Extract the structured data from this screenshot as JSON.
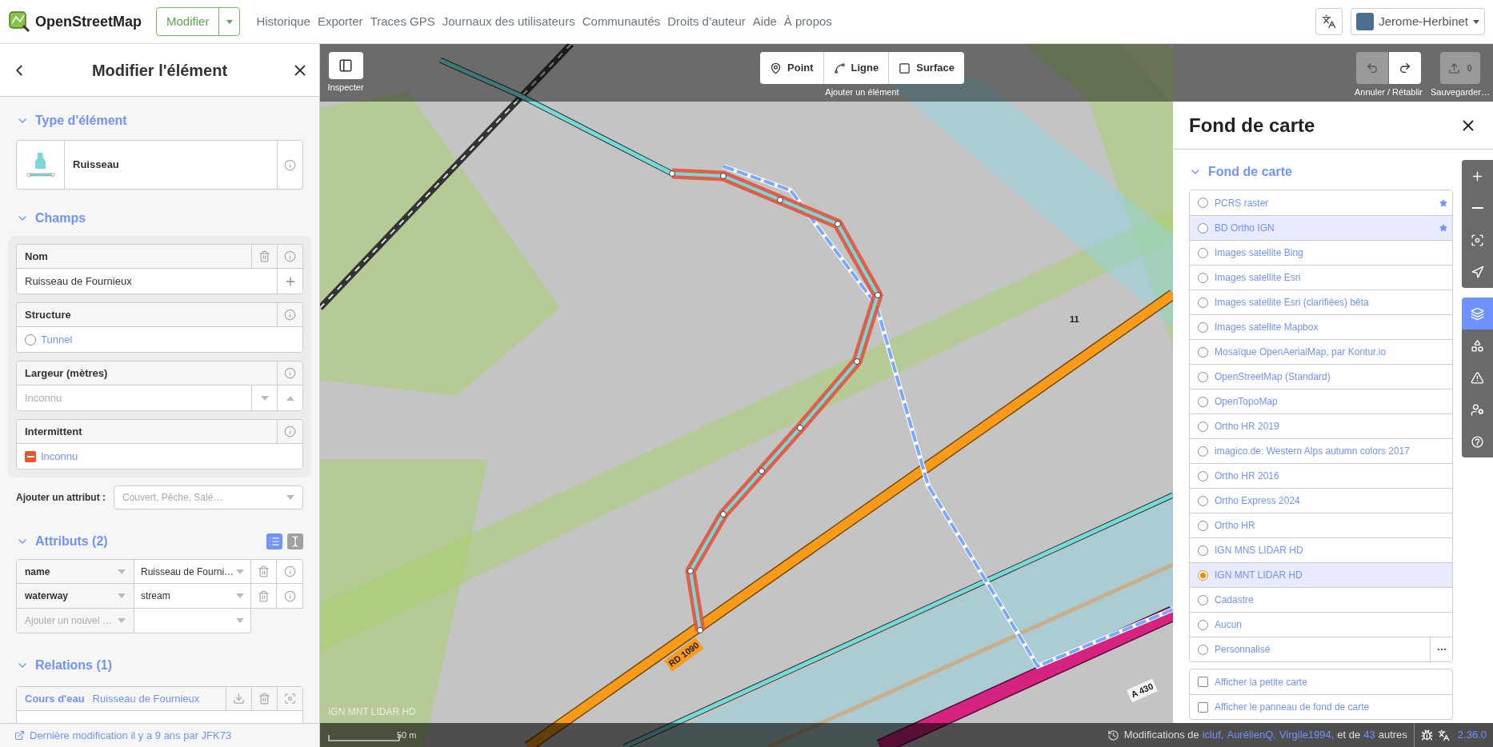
{
  "nav": {
    "logo": "OpenStreetMap",
    "edit": "Modifier",
    "links": [
      "Historique",
      "Exporter",
      "Traces GPS",
      "Journaux des utilisateurs",
      "Communautés",
      "Droits d’auteur",
      "Aide",
      "À propos"
    ],
    "user": "Jerome-Herbinet"
  },
  "sidebar": {
    "title": "Modifier l'élément",
    "preset_section": {
      "title": "Type d'élément",
      "expanded": true
    },
    "preset": "Ruisseau",
    "fields_section": {
      "title": "Champs",
      "expanded": true
    },
    "fields": [
      {
        "kind": "text",
        "label": "Nom",
        "value": "Ruisseau de Fournieux"
      },
      {
        "kind": "check",
        "label": "Structure",
        "option": "Tunnel",
        "checked": false
      },
      {
        "kind": "number",
        "label": "Largeur (mètres)",
        "placeholder": "Inconnu"
      },
      {
        "kind": "tristate",
        "label": "Intermittent",
        "option": "Inconnu",
        "indeterminate": true
      }
    ],
    "add_field": {
      "label": "Ajouter un attribut :",
      "placeholder": "Couvert, Pêche, Salé…"
    },
    "tags_section": {
      "title": "Attributs (2)",
      "expanded": true
    },
    "tag_views": [
      {
        "kind": "list",
        "selected": true
      },
      {
        "kind": "text",
        "selected": false
      }
    ],
    "tags": [
      {
        "key": "name",
        "value": "Ruisseau de Fourni…"
      },
      {
        "key": "waterway",
        "value": "stream"
      }
    ],
    "new_tag_placeholder": "Ajouter un nouvel …",
    "relations_section": {
      "title": "Relations (1)",
      "expanded": true
    },
    "relations": [
      {
        "role": "Cours d'eau",
        "name": "Ruisseau de Fournieux"
      }
    ],
    "footer": "Dernière modification il y a 9 ans par JFK73"
  },
  "toolbar": {
    "inspect": "Inspecter",
    "modes": [
      {
        "kind": "point",
        "label": "Point"
      },
      {
        "kind": "line",
        "label": "Ligne"
      },
      {
        "kind": "area",
        "label": "Surface"
      }
    ],
    "add_caption": "Ajouter un élément",
    "undo_disabled": true,
    "redo_disabled": false,
    "history_caption": "Annuler / Rétablir",
    "save_count": "0",
    "save_disabled": true,
    "save_caption": "Sauvegarder…"
  },
  "map": {
    "labels": [
      {
        "kind": "road",
        "text": "RD 1090"
      },
      {
        "kind": "motorway",
        "text": "A 430"
      },
      {
        "kind": "node",
        "text": "11"
      }
    ],
    "attribution": "IGN MNT LIDAR HD",
    "scale": "50 m"
  },
  "background_panel": {
    "title": "Fond de carte",
    "section": {
      "title": "Fond de carte",
      "expanded": true
    },
    "items": [
      {
        "kind": "imagery",
        "label": "PCRS raster",
        "selected": false,
        "highlighted": false,
        "starred": true
      },
      {
        "kind": "imagery",
        "label": "BD Ortho IGN",
        "selected": false,
        "highlighted": true,
        "starred": true
      },
      {
        "kind": "imagery",
        "label": "Images satellite Bing",
        "selected": false,
        "highlighted": false,
        "starred": false
      },
      {
        "kind": "imagery",
        "label": "Images satellite Esri",
        "selected": false,
        "highlighted": false,
        "starred": false
      },
      {
        "kind": "imagery",
        "label": "Images satellite Esri (clarifiées) bêta",
        "selected": false,
        "highlighted": false,
        "starred": false
      },
      {
        "kind": "imagery",
        "label": "Images satellite Mapbox",
        "selected": false,
        "highlighted": false,
        "starred": false
      },
      {
        "kind": "imagery",
        "label": "Mosaïque OpenAerialMap, par Kontur.io",
        "selected": false,
        "highlighted": false,
        "starred": false
      },
      {
        "kind": "imagery",
        "label": "OpenStreetMap (Standard)",
        "selected": false,
        "highlighted": false,
        "starred": false
      },
      {
        "kind": "imagery",
        "label": "OpenTopoMap",
        "selected": false,
        "highlighted": false,
        "starred": false
      },
      {
        "kind": "imagery",
        "label": "Ortho HR 2019",
        "selected": false,
        "highlighted": false,
        "starred": false
      },
      {
        "kind": "imagery",
        "label": "imagico.de: Western Alps autumn colors 2017",
        "selected": false,
        "highlighted": false,
        "starred": false
      },
      {
        "kind": "imagery",
        "label": "Ortho HR 2016",
        "selected": false,
        "highlighted": false,
        "starred": false
      },
      {
        "kind": "imagery",
        "label": "Ortho Express 2024",
        "selected": false,
        "highlighted": false,
        "starred": false
      },
      {
        "kind": "imagery",
        "label": "Ortho HR",
        "selected": false,
        "highlighted": false,
        "starred": false
      },
      {
        "kind": "imagery",
        "label": "IGN MNS LIDAR HD",
        "selected": false,
        "highlighted": false,
        "starred": false
      },
      {
        "kind": "imagery",
        "label": "IGN MNT LIDAR HD",
        "selected": true,
        "highlighted": true,
        "starred": false
      },
      {
        "kind": "imagery",
        "label": "Cadastre",
        "selected": false,
        "highlighted": false,
        "starred": false
      },
      {
        "kind": "imagery",
        "label": "Aucun",
        "selected": false,
        "highlighted": false,
        "starred": false
      },
      {
        "kind": "custom",
        "label": "Personnalisé",
        "selected": false,
        "highlighted": false,
        "starred": false
      }
    ],
    "options": [
      {
        "label": "Afficher la petite carte",
        "checked": false
      },
      {
        "label": "Afficher le panneau de fond de carte",
        "checked": false
      }
    ]
  },
  "map_controls": {
    "zoom": [
      {
        "kind": "zoom-in"
      },
      {
        "kind": "zoom-out"
      },
      {
        "kind": "zoom-selection"
      },
      {
        "kind": "locate"
      }
    ],
    "panes": [
      {
        "kind": "background",
        "selected": true
      },
      {
        "kind": "map-data",
        "selected": false
      },
      {
        "kind": "issues",
        "selected": false
      },
      {
        "kind": "preferences",
        "selected": false
      },
      {
        "kind": "help",
        "selected": false
      }
    ]
  },
  "footer": {
    "prefix": "Modifications de",
    "users": [
      "icluf,",
      "AurélienQ,",
      "Virgile1994,"
    ],
    "middle": "et de",
    "count": "43",
    "suffix": "autres",
    "version": "2.36.0"
  }
}
